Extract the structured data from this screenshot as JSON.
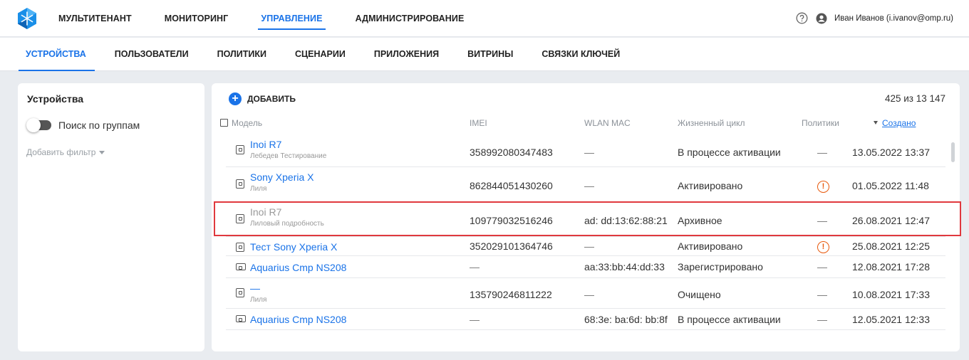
{
  "topbar": {
    "nav": [
      "МУЛЬТИТЕНАНТ",
      "МОНИТОРИНГ",
      "УПРАВЛЕНИЕ",
      "АДМИНИСТРИРОВАНИЕ"
    ],
    "active_index": 2,
    "user": "Иван Иванов (i.ivanov@omp.ru)"
  },
  "subnav": {
    "tabs": [
      "УСТРОЙСТВА",
      "ПОЛЬЗОВАТЕЛИ",
      "ПОЛИТИКИ",
      "СЦЕНАРИИ",
      "ПРИЛОЖЕНИЯ",
      "ВИТРИНЫ",
      "СВЯЗКИ КЛЮЧЕЙ"
    ],
    "active_index": 0
  },
  "sidebar": {
    "title": "Устройства",
    "group_search_label": "Поиск по группам",
    "group_search_enabled": false,
    "add_filter_label": "Добавить фильтр"
  },
  "main": {
    "add_label": "ДОБАВИТЬ",
    "count": "425 из 13 147",
    "columns": {
      "model": "Модель",
      "imei": "IMEI",
      "mac": "WLAN MAC",
      "lifecycle": "Жизненный цикл",
      "policies": "Политики",
      "created": "Создано"
    },
    "rows": [
      {
        "model": "Inoi R7",
        "sub": "Лебедев Тестирование",
        "imei": "358992080347483",
        "mac": "—",
        "status": "В процессе активации",
        "policy": "—",
        "created": "13.05.2022 13:37",
        "icon": "phone",
        "archived": false
      },
      {
        "model": "Sony Xperia X",
        "sub": "Лиля",
        "imei": "862844051430260",
        "mac": "—",
        "status": "Активировано",
        "policy": "!",
        "created": "01.05.2022 11:48",
        "icon": "phone",
        "archived": false
      },
      {
        "model": "Inoi R7",
        "sub": "Лиловый подробность",
        "imei": "109779032516246",
        "mac": "ad: dd:13:62:88:21",
        "status": "Архивное",
        "policy": "—",
        "created": "26.08.2021 12:47",
        "icon": "phone",
        "archived": true
      },
      {
        "model": "Тест Sony Xperia X",
        "sub": "",
        "imei": "352029101364746",
        "mac": "—",
        "status": "Активировано",
        "policy": "!",
        "created": "25.08.2021 12:25",
        "icon": "phone",
        "archived": false
      },
      {
        "model": "Aquarius Cmp NS208",
        "sub": "",
        "imei": "—",
        "mac": "aa:33:bb:44:dd:33",
        "status": "Зарегистрировано",
        "policy": "—",
        "created": "12.08.2021 17:28",
        "icon": "tablet",
        "archived": false
      },
      {
        "model": "—",
        "sub": "Лиля",
        "imei": "135790246811222",
        "mac": "—",
        "status": "Очищено",
        "policy": "—",
        "created": "10.08.2021 17:33",
        "icon": "phone",
        "archived": false
      },
      {
        "model": "Aquarius Cmp NS208",
        "sub": "",
        "imei": "—",
        "mac": "68:3e: ba:6d: bb:8f",
        "status": "В процессе активации",
        "policy": "—",
        "created": "12.05.2021 12:33",
        "icon": "tablet",
        "archived": false
      }
    ],
    "highlighted_row_index": 2
  },
  "colors": {
    "accent": "#1a73e8",
    "warning": "#e8590c",
    "highlight": "#e0393e"
  }
}
